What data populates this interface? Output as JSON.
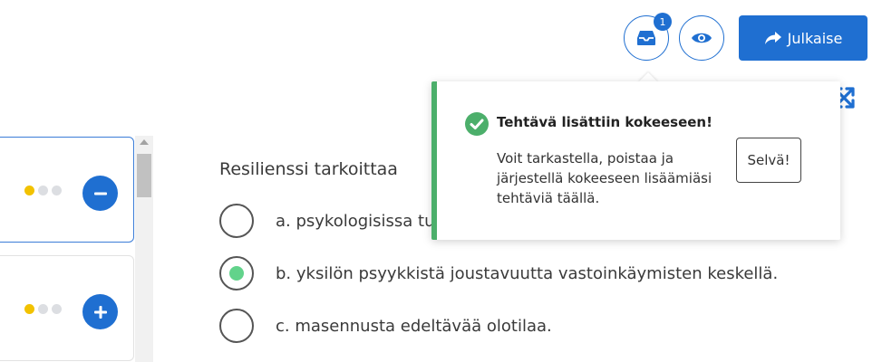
{
  "header": {
    "inbox_badge": "1",
    "publish_label": "Julkaise"
  },
  "question": {
    "prompt": "Resilienssi tarkoittaa",
    "options": [
      {
        "label": "a. psykologisissa tu",
        "selected": false
      },
      {
        "label": "b. yksilön psyykkistä joustavuutta vastoinkäymisten keskellä.",
        "selected": true
      },
      {
        "label": "c. masennusta edeltävää olotilaa.",
        "selected": false
      }
    ]
  },
  "popover": {
    "title": "Tehtävä lisättiin kokeeseen!",
    "body": "Voit tarkastella, poistaa ja järjestellä kokeeseen lisäämiäsi tehtäviä täällä.",
    "ok_label": "Selvä!"
  },
  "colors": {
    "primary": "#1f6fd1",
    "success": "#4caf6b",
    "selected_radio": "#62d38b",
    "difficulty_dot": "#f2c200"
  }
}
